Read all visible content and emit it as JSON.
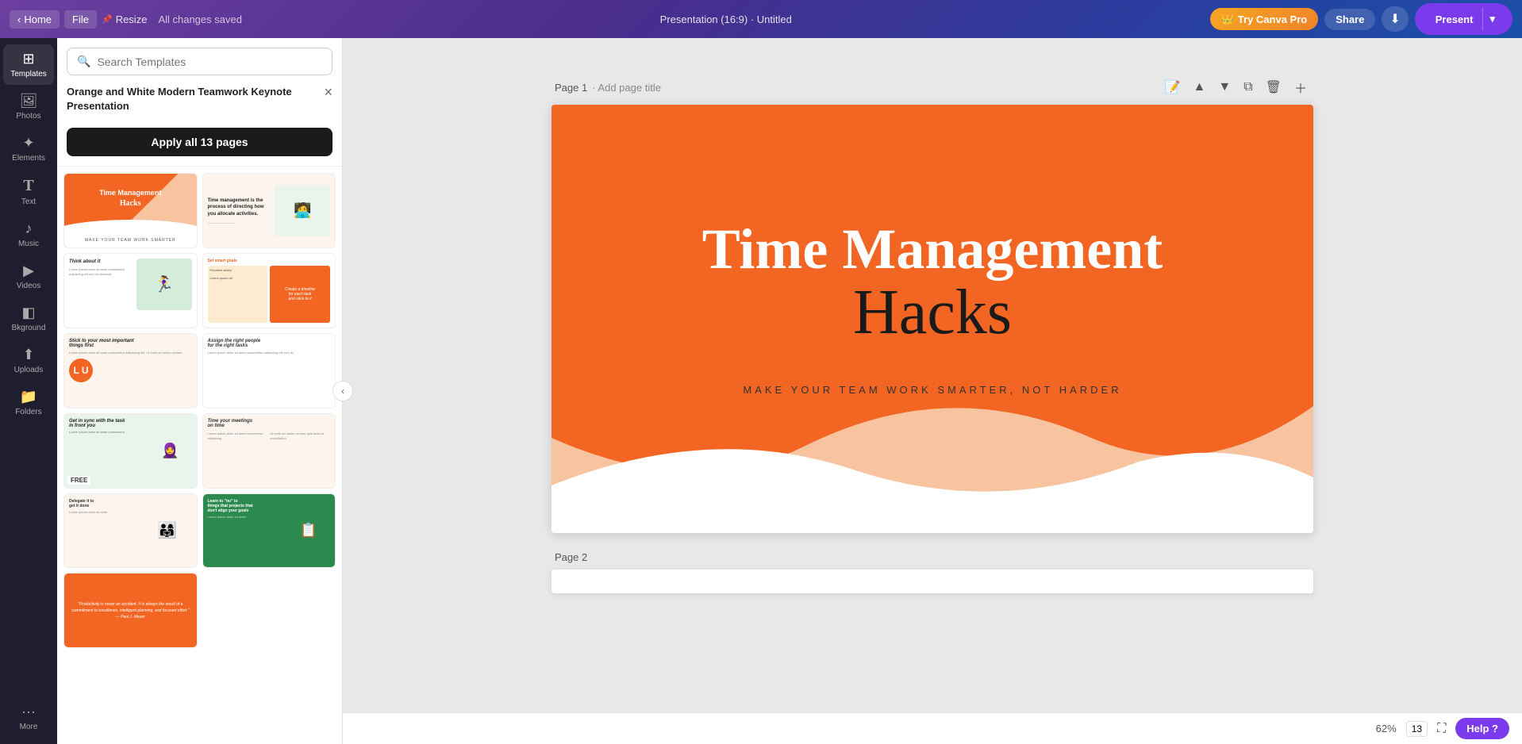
{
  "topbar": {
    "home_label": "Home",
    "file_label": "File",
    "resize_label": "Resize",
    "all_changes_saved": "All changes saved",
    "presentation_title": "Presentation (16:9) · Untitled",
    "try_canva_pro": "Try Canva Pro",
    "share_label": "Share",
    "download_icon": "⬇",
    "present_label": "Present",
    "present_arrow": "▾"
  },
  "sidebar": {
    "items": [
      {
        "id": "templates",
        "icon": "⊞",
        "label": "Templates",
        "active": true
      },
      {
        "id": "photos",
        "icon": "🖼",
        "label": "Photos",
        "active": false
      },
      {
        "id": "elements",
        "icon": "✦",
        "label": "Elements",
        "active": false
      },
      {
        "id": "text",
        "icon": "T",
        "label": "Text",
        "active": false
      },
      {
        "id": "music",
        "icon": "♪",
        "label": "Music",
        "active": false
      },
      {
        "id": "videos",
        "icon": "▶",
        "label": "Videos",
        "active": false
      },
      {
        "id": "background",
        "icon": "◧",
        "label": "Bkground",
        "active": false
      },
      {
        "id": "uploads",
        "icon": "⬆",
        "label": "Uploads",
        "active": false
      },
      {
        "id": "folders",
        "icon": "📁",
        "label": "Folders",
        "active": false
      },
      {
        "id": "more",
        "icon": "···",
        "label": "More",
        "active": false
      }
    ]
  },
  "search": {
    "placeholder": "Search Templates"
  },
  "template": {
    "title": "Orange and White Modern Teamwork Keynote Presentation",
    "apply_button": "Apply all 13 pages",
    "close_icon": "×"
  },
  "slide1": {
    "title_main": "Time Management",
    "title_script": "Hacks",
    "subtitle": "MAKE YOUR TEAM WORK SMARTER, NOT HARDER"
  },
  "pages": {
    "page1_label": "Page 1",
    "page1_add_title": "· Add page title",
    "page2_label": "Page 2"
  },
  "bottom": {
    "zoom_level": "62%",
    "page_count": "13",
    "help_label": "Help ?"
  }
}
